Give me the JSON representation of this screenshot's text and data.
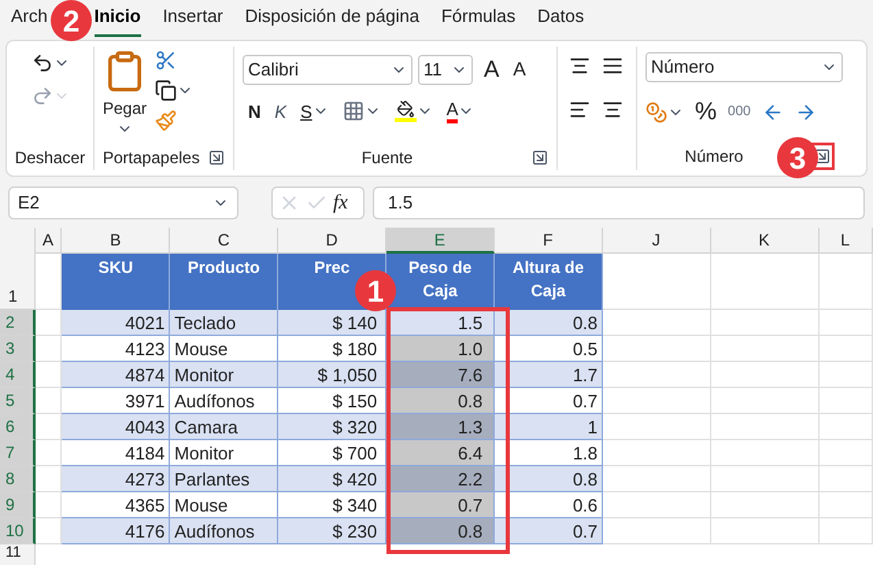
{
  "tabs": [
    {
      "label": "Arch",
      "selected": false
    },
    {
      "label": "Inicio",
      "selected": true
    },
    {
      "label": "Insertar",
      "selected": false
    },
    {
      "label": "Disposición de página",
      "selected": false
    },
    {
      "label": "Fórmulas",
      "selected": false
    },
    {
      "label": "Datos",
      "selected": false
    }
  ],
  "ribbon": {
    "font_name": "Calibri",
    "font_size": "11",
    "bold": "N",
    "italic": "K",
    "underline": "S",
    "font_color_letter": "A",
    "grow_letter": "A",
    "shrink_letter": "A",
    "percent": "%",
    "thousands": "000",
    "number_format": "Número",
    "groups": [
      "Deshacer",
      "Portapapeles",
      "Fuente",
      "Número"
    ],
    "paste_label": "Pegar"
  },
  "formula_bar": {
    "name_box": "E2",
    "fx": "fx",
    "value": "1.5"
  },
  "columns": [
    {
      "label": "A",
      "selected": false
    },
    {
      "label": "B",
      "selected": false
    },
    {
      "label": "C",
      "selected": false
    },
    {
      "label": "D",
      "selected": false
    },
    {
      "label": "E",
      "selected": true
    },
    {
      "label": "F",
      "selected": false
    },
    {
      "label": "J",
      "selected": false
    },
    {
      "label": "K",
      "selected": false
    },
    {
      "label": "L",
      "selected": false
    }
  ],
  "table": {
    "headers": [
      "SKU",
      "Producto",
      "Prec",
      "Peso de Caja",
      "Altura de Caja"
    ],
    "rows": [
      {
        "n": "2",
        "sku": "4021",
        "producto": "Teclado",
        "precio": "$ 140",
        "peso": "1.5",
        "altura": "0.8",
        "selected": true,
        "active": true
      },
      {
        "n": "3",
        "sku": "4123",
        "producto": "Mouse",
        "precio": "$ 180",
        "peso": "1.0",
        "altura": "0.5",
        "selected": true,
        "active": false
      },
      {
        "n": "4",
        "sku": "4874",
        "producto": "Monitor",
        "precio": "$ 1,050",
        "peso": "7.6",
        "altura": "1.7",
        "selected": true,
        "active": false
      },
      {
        "n": "5",
        "sku": "3971",
        "producto": "Audífonos",
        "precio": "$ 150",
        "peso": "0.8",
        "altura": "0.7",
        "selected": true,
        "active": false
      },
      {
        "n": "6",
        "sku": "4043",
        "producto": "Camara",
        "precio": "$ 320",
        "peso": "1.3",
        "altura": "1",
        "selected": true,
        "active": false
      },
      {
        "n": "7",
        "sku": "4184",
        "producto": "Monitor",
        "precio": "$ 700",
        "peso": "6.4",
        "altura": "1.8",
        "selected": true,
        "active": false
      },
      {
        "n": "8",
        "sku": "4273",
        "producto": "Parlantes",
        "precio": "$ 420",
        "peso": "2.2",
        "altura": "0.8",
        "selected": true,
        "active": false
      },
      {
        "n": "9",
        "sku": "4365",
        "producto": "Mouse",
        "precio": "$ 340",
        "peso": "0.7",
        "altura": "0.6",
        "selected": true,
        "active": false
      },
      {
        "n": "10",
        "sku": "4176",
        "producto": "Audífonos",
        "precio": "$ 230",
        "peso": "0.8",
        "altura": "0.7",
        "selected": true,
        "active": false
      }
    ]
  },
  "header_row_number": "1",
  "last_row_number": "11",
  "callouts": [
    "1",
    "2",
    "3"
  ]
}
